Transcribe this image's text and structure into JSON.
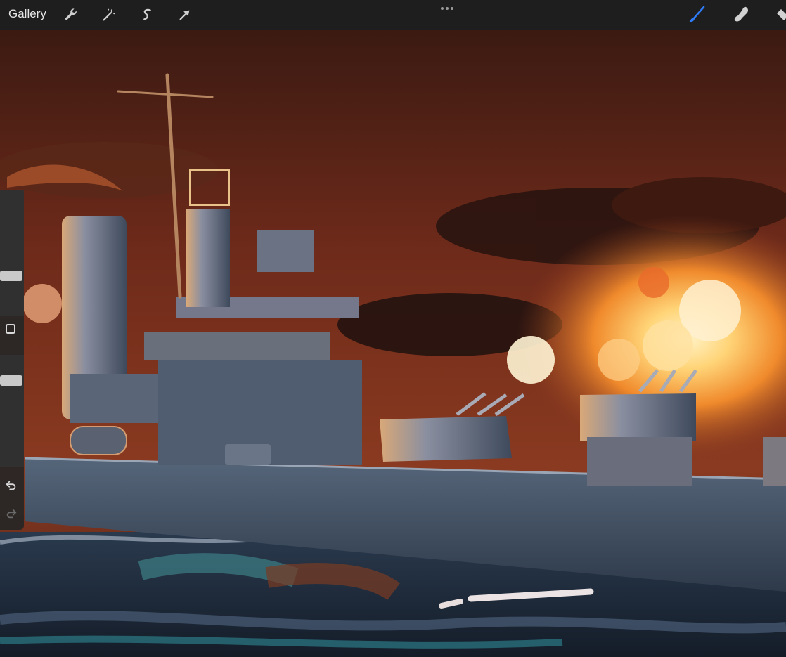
{
  "toolbar": {
    "gallery_label": "Gallery",
    "left_tools": [
      {
        "name": "actions",
        "icon": "wrench-icon"
      },
      {
        "name": "adjustments",
        "icon": "magic-wand-icon"
      },
      {
        "name": "selection",
        "icon": "selection-s-icon"
      },
      {
        "name": "transform",
        "icon": "arrow-cursor-icon"
      }
    ],
    "more_icon": "more-dots-icon",
    "right_tools": [
      {
        "name": "paint",
        "icon": "brush-icon",
        "active": true
      },
      {
        "name": "smudge",
        "icon": "smudge-finger-icon",
        "active": false
      },
      {
        "name": "erase",
        "icon": "eraser-icon",
        "active": false
      }
    ],
    "active_color": "#2f7bf5"
  },
  "sidebar": {
    "brush_size_level": 0.3,
    "brush_opacity_level": 0.2,
    "modify_button_icon": "square-icon",
    "undo_icon": "undo-arrow-icon",
    "redo_icon": "redo-arrow-icon"
  },
  "canvas": {
    "subject": "battleship-painting-icon",
    "colors": {
      "sky_dark": "#3a1c12",
      "sky_mid": "#7a2e1c",
      "fire": "#f4a23a",
      "hull": "#4a5a6e",
      "sea": "#1c2836"
    }
  }
}
